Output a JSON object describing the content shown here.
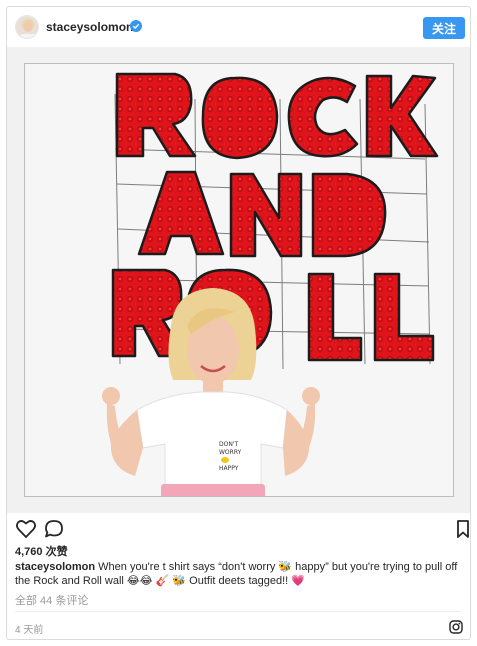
{
  "header": {
    "username": "staceysolomon",
    "follow_label": "关注"
  },
  "post": {
    "likes": "4,760 次赞",
    "caption_user": "staceysolomon",
    "caption_text": " When you're t shirt says “don't worry 🐝 happy” but you're trying to pull off the Rock and Roll wall 😂😂 🎸 🐝 Outfit deets tagged!! 💗",
    "comments_link": "全部 44 条评论",
    "timestamp": "4 天前"
  },
  "icons": {
    "like": "heart-icon",
    "comment": "comment-icon",
    "save": "bookmark-icon",
    "brand": "instagram-icon",
    "verified": "verified-badge-icon"
  },
  "colors": {
    "follow_button": "#3897f0",
    "verified": "#3897f0",
    "flowers": "#e0151b",
    "shirt_text": "#262626"
  },
  "photo": {
    "shirt_print_line1": "DON'T",
    "shirt_print_line2": "WORRY",
    "shirt_print_line3": "HAPPY"
  }
}
